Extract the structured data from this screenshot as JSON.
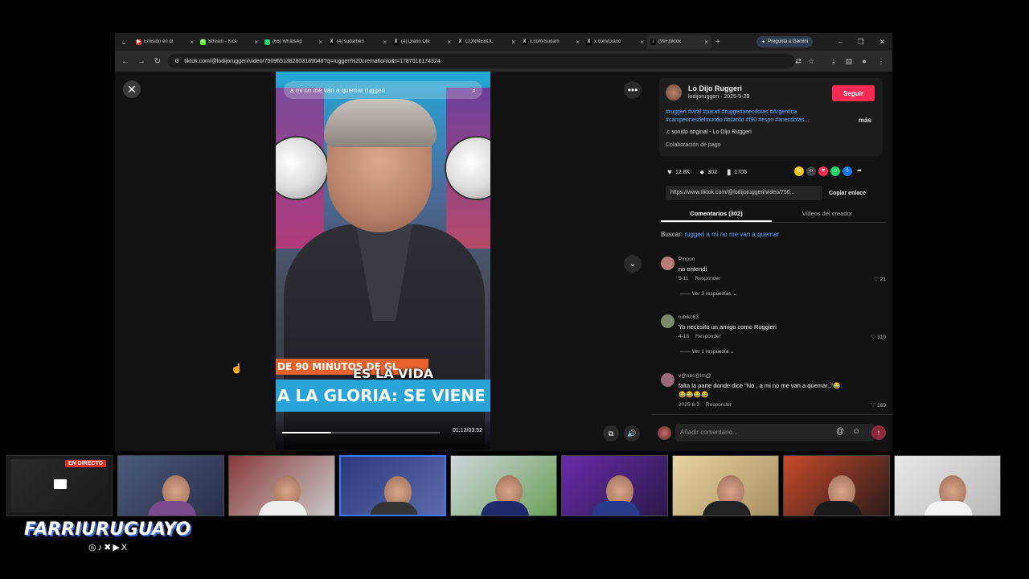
{
  "browser": {
    "tabs": [
      {
        "label": "Emisión en di",
        "fav_color": "#e53935",
        "fav": "▶"
      },
      {
        "label": "Stream - Kick",
        "fav_color": "#53fc18",
        "fav": "K"
      },
      {
        "label": "(66) WhatsAp",
        "fav_color": "#25d366",
        "fav": "○"
      },
      {
        "label": "(4) sudameri",
        "fav_color": "#000000",
        "fav": "X"
      },
      {
        "label": "(4) Diario Olé",
        "fav_color": "#000000",
        "fav": "X"
      },
      {
        "label": "CONMEBOL",
        "fav_color": "#000000",
        "fav": "X"
      },
      {
        "label": "x.com/Sudam",
        "fav_color": "#000000",
        "fav": "X"
      },
      {
        "label": "x.com/Diario",
        "fav_color": "#000000",
        "fav": "X"
      },
      {
        "label": "(99+)tiktok",
        "fav_color": "#000000",
        "fav": "♪"
      }
    ],
    "gemini_label": "Pregunta a Gemini",
    "url": "tiktok.com/@lodijoruggeri/video/7509651382803189048?q=ruggeri%20cremationio&t=1787016174324"
  },
  "video": {
    "search_text": "a mi no me van a quemar ruggeri",
    "caption_strip": "DE 90 MINUTOS DE GL",
    "caption_big": "ES LA VIDA",
    "caption_blue": "A LA GLORIA: SE VIENE LA",
    "time": "01:12/03:52",
    "progress": 0.31
  },
  "panel": {
    "creator_name": "Lo Dijo Ruggeri",
    "creator_handle": "lodijoruggeri · 2025-5-28",
    "follow_label": "Seguir",
    "hashtags_line1": "#ruggeri #viral #parati #ruggerianecdotas #Argentina",
    "hashtags_line2": "#campeonesdelmundo #bilardo #f90 #espn #anecdotas...",
    "more_label": "más",
    "sound": "♫  sonido original - Lo Dijo Ruggeri",
    "paid": "Colaboración de pago",
    "likes": "12.8K",
    "comments_count": "302",
    "saves": "1705",
    "link_text": "https://www.tiktok.com/@lodijoruggeri/video/750...",
    "copy_label": "Copiar enlace",
    "tab_comments": "Comentarios (302)",
    "tab_creator": "Videos del creador",
    "search_prefix": "Buscar:",
    "search_query": "ruggeri a mi no me van a quemar",
    "comments": [
      {
        "user": "Pinpon",
        "text": "no entendí",
        "date": "5-11",
        "reply": "Responder",
        "likes": "♡ 21",
        "replies": "Ver 3 respuestas ⌄",
        "av": "#b97a7a"
      },
      {
        "user": "rubiko83",
        "text": "Yo necesito un amigo como Ruggieri",
        "date": "4-18",
        "reply": "Responder",
        "likes": "♡ 310",
        "replies": "Ver 1 respuesta ⌄",
        "av": "#7a8a6a"
      },
      {
        "user": "v@nes@lm@",
        "text": "falta la parte donde dice \"No , a mi no me van a quemar..\"😂😂😂😂😂",
        "date": "2025-6-3",
        "reply": "Responder",
        "likes": "♡ 269",
        "replies": "",
        "av": "#9a6a7a"
      }
    ],
    "comment_placeholder": "Añadir comentario..."
  },
  "stream": {
    "live_label": "EN DIRECTO",
    "brand": "FARRIURUGUAYO",
    "socials": "◎♪✖▶X"
  },
  "colors": {
    "follow": "#fe2c55",
    "link": "#5ea8ff",
    "live": "#e0301e"
  }
}
